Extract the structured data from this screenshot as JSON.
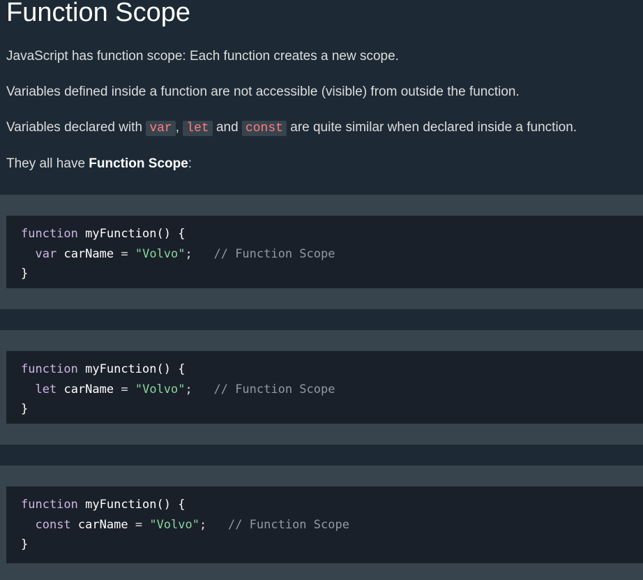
{
  "page": {
    "title": "Function Scope"
  },
  "paragraphs": {
    "p1": "JavaScript has function scope: Each function creates a new scope.",
    "p2": "Variables defined inside a function are not accessible (visible) from outside the function.",
    "p3_before": "Variables declared with ",
    "p3_code1": "var",
    "p3_sep1": ", ",
    "p3_code2": "let",
    "p3_sep2": " and ",
    "p3_code3": "const",
    "p3_after": " are quite similar when declared inside a function.",
    "p4_before": "They all have ",
    "p4_bold": "Function Scope",
    "p4_after": ":"
  },
  "examples": [
    {
      "keyword_fn": "function",
      "fn_name": "myFunction() {",
      "decl": "var",
      "var_name": "carName",
      "equals": "=",
      "value": "\"Volvo\"",
      "semicolon": ";",
      "comment": "// Function Scope",
      "close": "}"
    },
    {
      "keyword_fn": "function",
      "fn_name": "myFunction() {",
      "decl": "let",
      "var_name": "carName",
      "equals": "=",
      "value": "\"Volvo\"",
      "semicolon": ";",
      "comment": "// Function Scope",
      "close": "}"
    },
    {
      "keyword_fn": "function",
      "fn_name": "myFunction() {",
      "decl": "const",
      "var_name": "carName",
      "equals": "=",
      "value": "\"Volvo\"",
      "semicolon": ";",
      "comment": "// Function Scope",
      "close": "}"
    }
  ],
  "colors": {
    "background": "#1d2a35",
    "example_bg": "#38444d",
    "code_bg": "#1a2029",
    "keyword": "#cdb6e6",
    "string": "#88d69f",
    "comment": "#8f9aa5",
    "inline_code": "#ff7d7d"
  }
}
